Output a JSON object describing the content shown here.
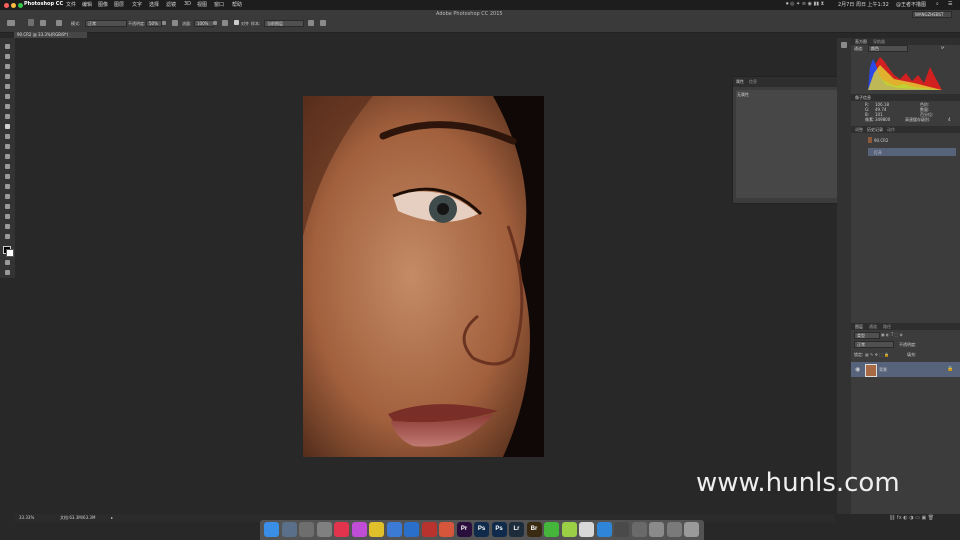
{
  "menubar": {
    "app_name": "Photoshop CC",
    "items": [
      "文件",
      "编辑",
      "图像",
      "图层",
      "文字",
      "选择",
      "滤镜",
      "3D",
      "视图",
      "窗口",
      "帮助"
    ],
    "clock": "2月7日 周日 上午1:32",
    "user": "@王者不撸图"
  },
  "window_title": "Adobe Photoshop CC 2015",
  "options": {
    "mode_label": "模式:",
    "mode_value": "正常",
    "opacity_label": "不透明度:",
    "opacity_value": "50%",
    "flow_label": "流量:",
    "flow_value": "100%",
    "align_label": "对齐",
    "sample_label": "样本:",
    "sample_value": "当前图层",
    "workspace": "WANGZHEBST"
  },
  "document": {
    "tab_label": "90.CR2 @ 33.3%(RGB/8*)"
  },
  "status": {
    "zoom": "33.33%",
    "doc_size": "文档:63.3M/63.3M"
  },
  "properties_panel": {
    "tab1": "属性",
    "tab2": "信息",
    "body_text": "无属性"
  },
  "histogram_panel": {
    "tab1": "直方图",
    "tab2": "导航器",
    "channel_label": "通道:",
    "channel_value": "颜色"
  },
  "info_panel": {
    "tab": "像子信息",
    "rows": [
      {
        "k": "R:",
        "v": "106.18",
        "k2": "色阶:",
        "v2": ""
      },
      {
        "k": "G:",
        "v": "49.74",
        "k2": "数量:",
        "v2": ""
      },
      {
        "k": "B:",
        "v": "101",
        "k2": "百分位:",
        "v2": ""
      },
      {
        "k": "像素:",
        "v": "349800",
        "k2": "高速缓存级别:",
        "v2": "4"
      }
    ]
  },
  "history_panel": {
    "tabs": [
      "调整",
      "历史记录",
      "动作"
    ],
    "snapshot": "90.CR2",
    "step": "打开"
  },
  "layers_panel": {
    "tabs": [
      "图层",
      "通道",
      "路径"
    ],
    "kind_label": "类型",
    "blend": "正常",
    "opacity_label": "不透明度:",
    "lock_label": "锁定:",
    "fill_label": "填充:",
    "layer_name": "背景"
  },
  "dock_apps": [
    {
      "name": "finder",
      "label": "",
      "color": "#3a8ee6"
    },
    {
      "name": "preview",
      "label": "",
      "color": "#5a6f8a"
    },
    {
      "name": "launchpad",
      "label": "",
      "color": "#6e6e6e"
    },
    {
      "name": "system-prefs",
      "label": "",
      "color": "#808080"
    },
    {
      "name": "calendar",
      "label": "",
      "color": "#e2344d"
    },
    {
      "name": "itunes",
      "label": "",
      "color": "#c04dd6"
    },
    {
      "name": "chrome",
      "label": "",
      "color": "#e0c02a"
    },
    {
      "name": "mail",
      "label": "",
      "color": "#3b7bd6"
    },
    {
      "name": "safari",
      "label": "",
      "color": "#2a6fc9"
    },
    {
      "name": "photo-booth",
      "label": "",
      "color": "#b8322e"
    },
    {
      "name": "photos",
      "label": "",
      "color": "#d6563b"
    },
    {
      "name": "premiere",
      "label": "Pr",
      "color": "#2a0f3d"
    },
    {
      "name": "photoshop",
      "label": "Ps",
      "color": "#0f2a4a"
    },
    {
      "name": "photoshop-2",
      "label": "Ps",
      "color": "#0f2a4a"
    },
    {
      "name": "lightroom",
      "label": "Lr",
      "color": "#1c2c3a"
    },
    {
      "name": "bridge",
      "label": "Br",
      "color": "#3a2a12"
    },
    {
      "name": "wechat",
      "label": "",
      "color": "#46b53c"
    },
    {
      "name": "messages",
      "label": "",
      "color": "#9bcf45"
    },
    {
      "name": "qq",
      "label": "",
      "color": "#d8d8d8"
    },
    {
      "name": "browser",
      "label": "",
      "color": "#2f86d9"
    },
    {
      "name": "iphone",
      "label": "",
      "color": "#4a4a4a"
    },
    {
      "name": "display",
      "label": "",
      "color": "#6a6a6a"
    },
    {
      "name": "keyboard",
      "label": "",
      "color": "#8a8a8a"
    },
    {
      "name": "downloads",
      "label": "",
      "color": "#7a7a7a"
    },
    {
      "name": "trash",
      "label": "",
      "color": "#9a9a9a"
    }
  ],
  "watermark": "www.hunls.com"
}
